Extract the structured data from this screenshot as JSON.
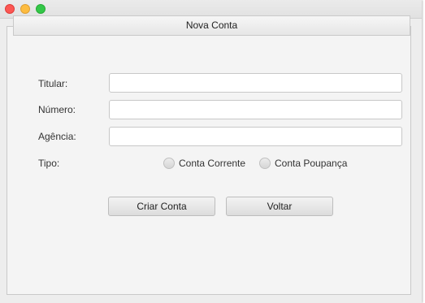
{
  "window": {
    "controls": [
      "close",
      "minimize",
      "zoom"
    ]
  },
  "panel": {
    "title": "Nova Conta"
  },
  "form": {
    "titular": {
      "label": "Titular:",
      "value": "",
      "placeholder": ""
    },
    "numero": {
      "label": "Número:",
      "value": "",
      "placeholder": ""
    },
    "agencia": {
      "label": "Agência:",
      "value": "",
      "placeholder": ""
    },
    "tipo": {
      "label": "Tipo:",
      "options": [
        "Conta Corrente",
        "Conta Poupança"
      ],
      "selected": null
    }
  },
  "buttons": {
    "create": "Criar Conta",
    "back": "Voltar"
  }
}
